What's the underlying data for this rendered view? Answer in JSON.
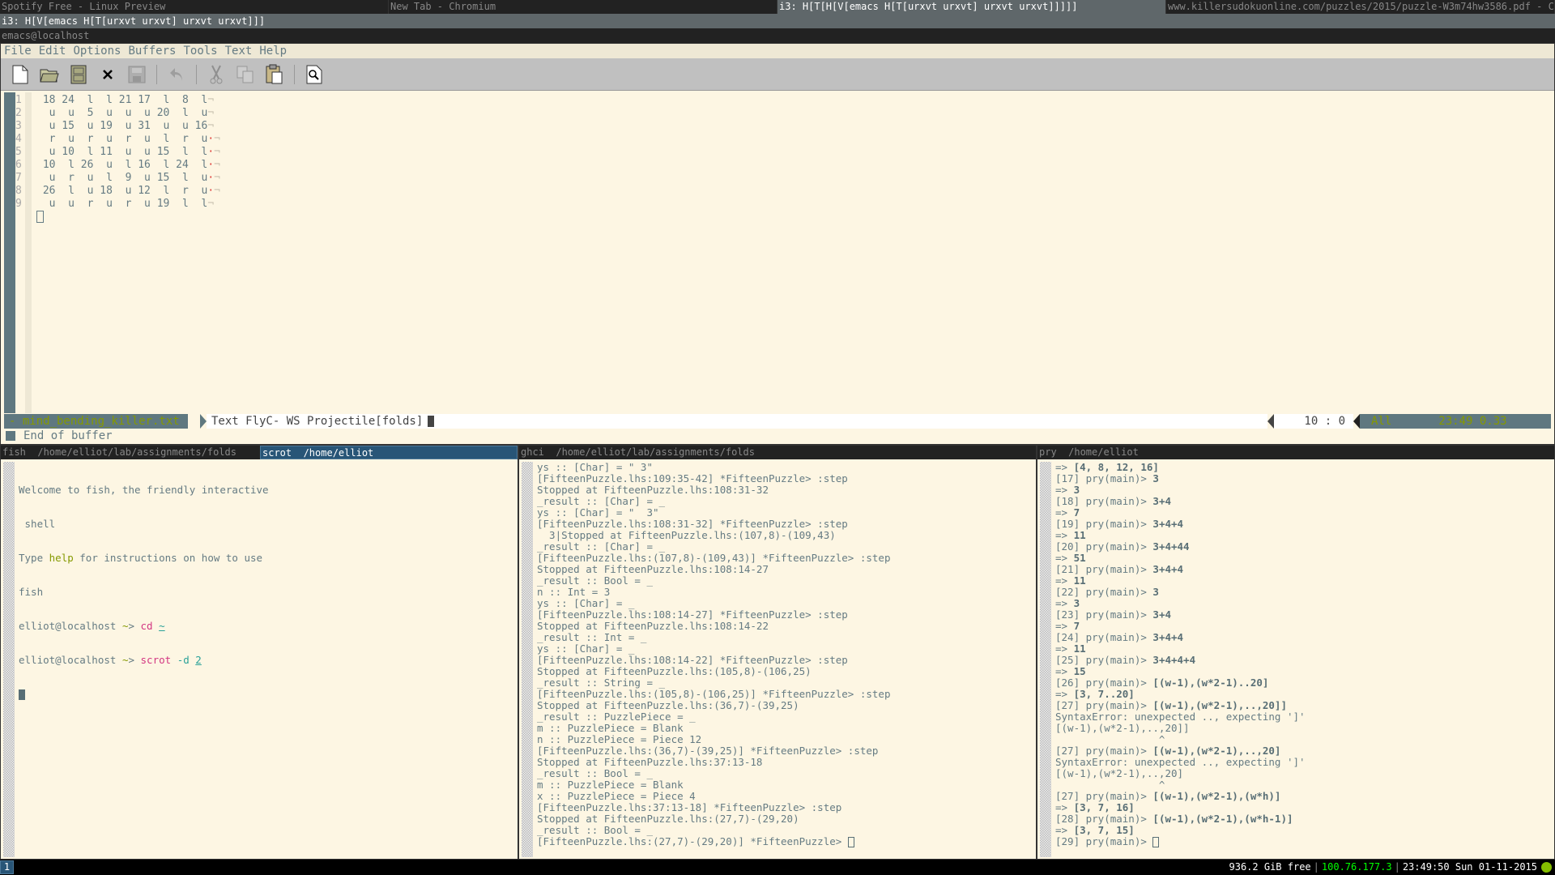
{
  "top_tabs": [
    {
      "label": "Spotify Free - Linux Preview",
      "active": false
    },
    {
      "label": "New Tab - Chromium",
      "active": false
    },
    {
      "label": "i3: H[T[H[V[emacs H[T[urxvt urxvt] urxvt urxvt]]]]]",
      "active": true
    },
    {
      "label": "www.killersudokuonline.com/puzzles/2015/puzzle-W3m74hw3586.pdf - Chromium",
      "active": false
    }
  ],
  "i3_container": "i3: H[V[emacs H[T[urxvt urxvt] urxvt urxvt]]]",
  "emacs": {
    "window_title": "emacs@localhost",
    "menu": [
      "File",
      "Edit",
      "Options",
      "Buffers",
      "Tools",
      "Text",
      "Help"
    ],
    "toolbar": [
      {
        "name": "new-file-icon",
        "glyph": "🗋",
        "enabled": true
      },
      {
        "name": "open-folder-icon",
        "glyph": "📂",
        "enabled": true
      },
      {
        "name": "dired-cabinet-icon",
        "glyph": "🗄",
        "enabled": true
      },
      {
        "name": "close-buffer-icon",
        "glyph": "✕",
        "enabled": true
      },
      {
        "name": "save-icon",
        "glyph": "💾",
        "enabled": false
      },
      {
        "name": "undo-icon",
        "glyph": "↶",
        "enabled": false
      },
      {
        "name": "cut-icon",
        "glyph": "✂",
        "enabled": false
      },
      {
        "name": "copy-icon",
        "glyph": "⎘",
        "enabled": false
      },
      {
        "name": "paste-icon",
        "glyph": "📋",
        "enabled": true
      },
      {
        "name": "search-icon",
        "glyph": "🔍",
        "enabled": true
      }
    ],
    "buffer_lines": [
      {
        "num": "1",
        "text": " 18 24  l  l 21 17  l  8  l",
        "trail": ""
      },
      {
        "num": "2",
        "text": "  u  u  5  u  u  u 20  l  u",
        "trail": ""
      },
      {
        "num": "3",
        "text": "  u 15  u 19  u 31  u  u 16",
        "trail": ""
      },
      {
        "num": "4",
        "text": "  r  u  r  u  r  u  l  r  u",
        "trail": "·"
      },
      {
        "num": "5",
        "text": "  u 10  l 11  u  u 15  l  l",
        "trail": "·"
      },
      {
        "num": "6",
        "text": " 10  l 26  u  l 16  l 24  l",
        "trail": "·"
      },
      {
        "num": "7",
        "text": "  u  r  u  l  9  u 15  l  u",
        "trail": "·"
      },
      {
        "num": "8",
        "text": " 26  l  u 18  u 12  l  r  u",
        "trail": "·"
      },
      {
        "num": "9",
        "text": "  u  u  r  u  r  u 19  l  l",
        "trail": ""
      }
    ],
    "eol_mark": "¬",
    "modeline": {
      "buffer": "- mind_bending_killer.txt",
      "modes": "Text FlyC- WS Projectile[folds]",
      "position": "10 :  0",
      "scroll": "All",
      "time_load": "23:49 0.33"
    },
    "minibuffer": "End of buffer"
  },
  "panes": [
    {
      "tabs": [
        {
          "label": "fish  /home/elliot/lab/assignments/folds",
          "active": false
        },
        {
          "label": "scrot  /home/elliot",
          "active": true
        }
      ],
      "lines": [
        "Welcome to fish, the friendly interactive",
        " shell"
      ],
      "help_line": {
        "pre": "Type ",
        "kw": "help",
        "post": " for instructions on how to use"
      },
      "help_line2": "fish",
      "prompts": [
        {
          "prompt": "elliot@localhost ",
          "tilde": "~",
          "arrow": "> ",
          "cmd": "cd",
          "arg": "~"
        },
        {
          "prompt": "elliot@localhost ",
          "tilde": "~",
          "arrow": "> ",
          "cmd": "scrot",
          "flag": " -d ",
          "arg": "2"
        }
      ]
    },
    {
      "tabs": [
        {
          "label": "ghci  /home/elliot/lab/assignments/folds",
          "active": false
        }
      ],
      "lines": [
        "ys :: [Char] = \" 3\"",
        "[FifteenPuzzle.lhs:109:35-42] *FifteenPuzzle> :step",
        "Stopped at FifteenPuzzle.lhs:108:31-32",
        "_result :: [Char] = _",
        "ys :: [Char] = \"  3\"",
        "[FifteenPuzzle.lhs:108:31-32] *FifteenPuzzle> :step",
        "  3|Stopped at FifteenPuzzle.lhs:(107,8)-(109,43)",
        "_result :: [Char] = _",
        "[FifteenPuzzle.lhs:(107,8)-(109,43)] *FifteenPuzzle> :step",
        "Stopped at FifteenPuzzle.lhs:108:14-27",
        "_result :: Bool = _",
        "n :: Int = 3",
        "ys :: [Char] = _",
        "[FifteenPuzzle.lhs:108:14-27] *FifteenPuzzle> :step",
        "Stopped at FifteenPuzzle.lhs:108:14-22",
        "_result :: Int = _",
        "ys :: [Char] = _",
        "[FifteenPuzzle.lhs:108:14-22] *FifteenPuzzle> :step",
        "Stopped at FifteenPuzzle.lhs:(105,8)-(106,25)",
        "_result :: String = _",
        "[FifteenPuzzle.lhs:(105,8)-(106,25)] *FifteenPuzzle> :step",
        "Stopped at FifteenPuzzle.lhs:(36,7)-(39,25)",
        "_result :: PuzzlePiece = _",
        "m :: PuzzlePiece = Blank",
        "n :: PuzzlePiece = Piece 12",
        "[FifteenPuzzle.lhs:(36,7)-(39,25)] *FifteenPuzzle> :step",
        "Stopped at FifteenPuzzle.lhs:37:13-18",
        "_result :: Bool = _",
        "m :: PuzzlePiece = Blank",
        "x :: PuzzlePiece = Piece 4",
        "[FifteenPuzzle.lhs:37:13-18] *FifteenPuzzle> :step",
        "Stopped at FifteenPuzzle.lhs:(27,7)-(29,20)",
        "_result :: Bool = _"
      ],
      "prompt": "[FifteenPuzzle.lhs:(27,7)-(29,20)] *FifteenPuzzle> "
    },
    {
      "tabs": [
        {
          "label": "pry  /home/elliot",
          "active": false
        }
      ],
      "lines": [
        {
          "p": "=> ",
          "b": "[4, 8, 12, 16]"
        },
        {
          "p": "[17] pry(main)> ",
          "b": "3"
        },
        {
          "p": "=> ",
          "b": "3"
        },
        {
          "p": "[18] pry(main)> ",
          "b": "3+4"
        },
        {
          "p": "=> ",
          "b": "7"
        },
        {
          "p": "[19] pry(main)> ",
          "b": "3+4+4"
        },
        {
          "p": "=> ",
          "b": "11"
        },
        {
          "p": "[20] pry(main)> ",
          "b": "3+4+44"
        },
        {
          "p": "=> ",
          "b": "51"
        },
        {
          "p": "[21] pry(main)> ",
          "b": "3+4+4"
        },
        {
          "p": "=> ",
          "b": "11"
        },
        {
          "p": "[22] pry(main)> ",
          "b": "3"
        },
        {
          "p": "=> ",
          "b": "3"
        },
        {
          "p": "[23] pry(main)> ",
          "b": "3+4"
        },
        {
          "p": "=> ",
          "b": "7"
        },
        {
          "p": "[24] pry(main)> ",
          "b": "3+4+4"
        },
        {
          "p": "=> ",
          "b": "11"
        },
        {
          "p": "[25] pry(main)> ",
          "b": "3+4+4+4"
        },
        {
          "p": "=> ",
          "b": "15"
        },
        {
          "p": "[26] pry(main)> ",
          "b": "[(w-1),(w*2-1)..20]"
        },
        {
          "p": "=> ",
          "b": "[3, 7..20]"
        },
        {
          "p": "[27] pry(main)> ",
          "b": "[(w-1),(w*2-1),..,20]]"
        },
        {
          "p": "SyntaxError: unexpected .., expecting ']'",
          "b": ""
        },
        {
          "p": "[(w-1),(w*2-1),..,20]]",
          "b": ""
        },
        {
          "p": "                 ^",
          "b": ""
        },
        {
          "p": "[27] pry(main)> ",
          "b": "[(w-1),(w*2-1),..,20]"
        },
        {
          "p": "SyntaxError: unexpected .., expecting ']'",
          "b": ""
        },
        {
          "p": "[(w-1),(w*2-1),..,20]",
          "b": ""
        },
        {
          "p": "                 ^",
          "b": ""
        },
        {
          "p": "[27] pry(main)> ",
          "b": "[(w-1),(w*2-1),(w*h)]"
        },
        {
          "p": "=> ",
          "b": "[3, 7, 16]"
        },
        {
          "p": "[28] pry(main)> ",
          "b": "[(w-1),(w*2-1),(w*h-1)]"
        },
        {
          "p": "=> ",
          "b": "[3, 7, 15]"
        }
      ],
      "prompt": "[29] pry(main)> "
    }
  ],
  "statusbar": {
    "workspace": "1",
    "disk": "936.2 GiB free",
    "ip": "100.76.177.3",
    "datetime": "23:49:50 Sun 01-11-2015",
    "ip_color": "#00ff00"
  }
}
